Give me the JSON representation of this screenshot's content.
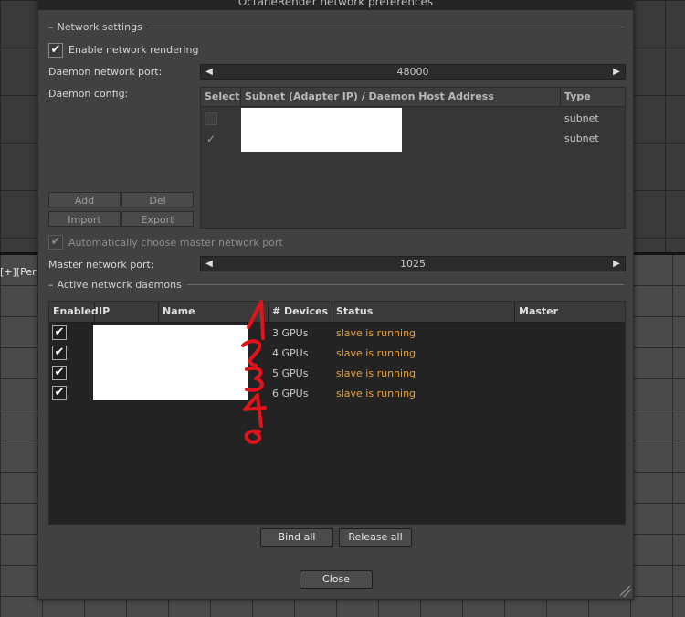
{
  "window": {
    "title": "OctaneRender network preferences"
  },
  "viewport": {
    "label": "[+][Per"
  },
  "network_settings": {
    "section_title": "Network settings",
    "enable_rendering": {
      "label": "Enable network rendering",
      "checked": true
    },
    "daemon_port": {
      "label": "Daemon network port:",
      "value": "48000"
    },
    "daemon_config": {
      "label": "Daemon config:",
      "columns": [
        "Select",
        "Subnet (Adapter IP) / Daemon Host Address",
        "Type"
      ],
      "rows": [
        {
          "selected": false,
          "address": "",
          "type": "subnet"
        },
        {
          "selected": true,
          "address": "",
          "type": "subnet"
        }
      ]
    },
    "buttons": {
      "add": "Add",
      "del": "Del",
      "import": "Import",
      "export": "Export"
    },
    "auto_master_port": {
      "label": "Automatically choose master network port",
      "checked": true
    },
    "master_port": {
      "label": "Master network port:",
      "value": "1025"
    }
  },
  "active_daemons": {
    "section_title": "Active network daemons",
    "columns": [
      "Enabled",
      "IP Address",
      "Name",
      "# Devices",
      "Status",
      "Master"
    ],
    "rows": [
      {
        "enabled": true,
        "ip": "",
        "name": "",
        "devices": "3 GPUs",
        "status": "slave is running",
        "master": ""
      },
      {
        "enabled": true,
        "ip": "",
        "name": "",
        "devices": "4 GPUs",
        "status": "slave is running",
        "master": ""
      },
      {
        "enabled": true,
        "ip": "",
        "name": "",
        "devices": "5 GPUs",
        "status": "slave is running",
        "master": ""
      },
      {
        "enabled": true,
        "ip": "",
        "name": "",
        "devices": "6 GPUs",
        "status": "slave is running",
        "master": ""
      }
    ],
    "bind_all": "Bind all",
    "release_all": "Release all"
  },
  "close_label": "Close",
  "icons": {
    "check": "checkmark-icon",
    "arrow_left": "arrow-left-icon",
    "arrow_right": "arrow-right-icon",
    "resize": "resize-grip-icon"
  },
  "colors": {
    "status_running": "#e9a23b",
    "annotation": "#e0141b"
  }
}
